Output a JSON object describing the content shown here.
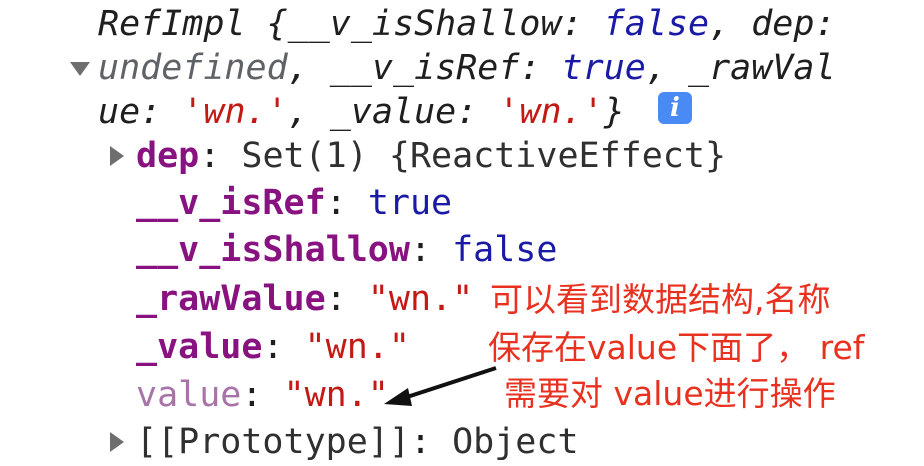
{
  "summary": {
    "line1": "RefImpl {__v_isShallow: false, dep:",
    "line2": "undefined, __v_isRef: true, _rawVal",
    "line3": "ue: 'wn.', _value: 'wn.'}",
    "info_glyph": "i"
  },
  "props": [
    {
      "key": "dep",
      "sep": ": ",
      "value": "Set(1) {ReactiveEffect}",
      "expandable": true
    },
    {
      "key": "__v_isRef",
      "sep": ": ",
      "value": "true"
    },
    {
      "key": "__v_isShallow",
      "sep": ": ",
      "value": "false"
    },
    {
      "key": "_rawValue",
      "sep": ": ",
      "value": "\"wn.\""
    },
    {
      "key": "_value",
      "sep": ": ",
      "value": "\"wn.\""
    },
    {
      "key": "value",
      "sep": ": ",
      "value": "\"wn.\""
    },
    {
      "key": "[[Prototype]]",
      "sep": ": ",
      "value": "Object",
      "expandable": true
    }
  ],
  "annotation": {
    "line1": "可以看到数据结构,名称",
    "line2": "保存在value下面了，  ref",
    "line3": "需要对 value进行操作",
    "color": "#e8311f"
  },
  "colors": {
    "key": "#881280",
    "boolean": "#1a1aa6",
    "string": "#c41a16",
    "accessor_key": "#a874a8"
  }
}
